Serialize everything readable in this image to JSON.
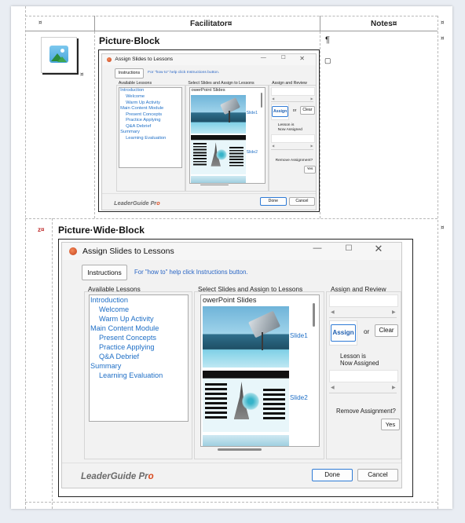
{
  "table": {
    "headers": {
      "facilitator": "Facilitator¤",
      "notes": "Notes¤"
    },
    "marks": {
      "cell": "¤",
      "row_end": "¤",
      "pilcrow": "¶",
      "numbering": "z¤",
      "small_square": "▢"
    }
  },
  "picture_block": {
    "title": "Picture·Block"
  },
  "picture_wide_block": {
    "title": "Picture·Wide·Block"
  },
  "dialog": {
    "title": "Assign Slides to Lessons",
    "minimize_icon": "minimize-icon",
    "maximize_icon": "maximize-icon",
    "close_icon": "close-icon",
    "instructions_label": "Instructions",
    "howto_text": "For \"how to\" help click Instructions button.",
    "available_lessons_label": "Available Lessons",
    "select_slides_label": "Select Slides and Assign to Lessons",
    "assign_review_label": "Assign and Review",
    "lessons": [
      {
        "text": "Introduction",
        "indent": 0
      },
      {
        "text": "Welcome",
        "indent": 1
      },
      {
        "text": "Warm Up Activity",
        "indent": 1
      },
      {
        "text": "Main Content Module",
        "indent": 0
      },
      {
        "text": "Present Concepts",
        "indent": 1
      },
      {
        "text": "Practice Applying",
        "indent": 1
      },
      {
        "text": "Q&A Debrief",
        "indent": 1
      },
      {
        "text": "Summary",
        "indent": 0
      },
      {
        "text": "Learning Evaluation",
        "indent": 1
      }
    ],
    "slides_header": "owerPoint Slides",
    "slide1_label": "Slide1",
    "slide2_label": "Slide2",
    "assign_label": "Assign",
    "or_label": "or",
    "clear_label": "Clear",
    "lesson_status_line1": "Lesson is",
    "lesson_status_line2": "Now Assigned",
    "remove_question": "Remove Assignment?",
    "yes_label": "Yes",
    "logo_text": "LeaderGuide Pr",
    "logo_o": "o",
    "done_label": "Done",
    "cancel_label": "Cancel",
    "colors": {
      "link": "#1f6fc6",
      "accent": "#2f7bd6",
      "logo_o": "#d94a1f"
    }
  }
}
